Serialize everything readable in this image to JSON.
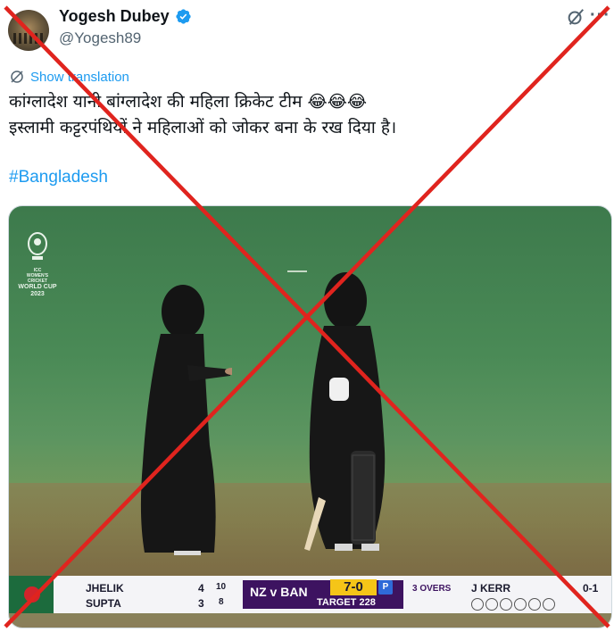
{
  "author": {
    "display_name": "Yogesh Dubey",
    "handle": "@Yogesh89"
  },
  "tweet": {
    "translate_label": "Show translation",
    "text_line1": "कांग्लादेश यानी बांग्लादेश की महिला क्रिकेट टीम 😂😂😂",
    "text_line2": "इस्लामी कट्टरपंथियों ने महिलाओं को जोकर बना के रख दिया है।",
    "hashtag": "#Bangladesh"
  },
  "media": {
    "logo": {
      "line1": "ICC",
      "line2": "WOMEN'S CRICKET",
      "line3": "WORLD CUP",
      "line4": "2023"
    },
    "scoreboard": {
      "batter1_name": "JHELIK",
      "batter1_runs": "4",
      "batter1_balls": "10",
      "batter2_name": "SUPTA",
      "batter2_runs": "3",
      "batter2_balls": "8",
      "match": "NZ v BAN",
      "score": "7-0",
      "powerplay": "P",
      "overs": "3 OVERS",
      "target": "TARGET 228",
      "bowler_name": "J KERR",
      "bowler_figures": "0-1"
    }
  },
  "overlay": "red-cross-fact-check-mark",
  "colors": {
    "link": "#1d9bf0",
    "verified": "#1d9bf0",
    "cross": "#e0241e"
  }
}
